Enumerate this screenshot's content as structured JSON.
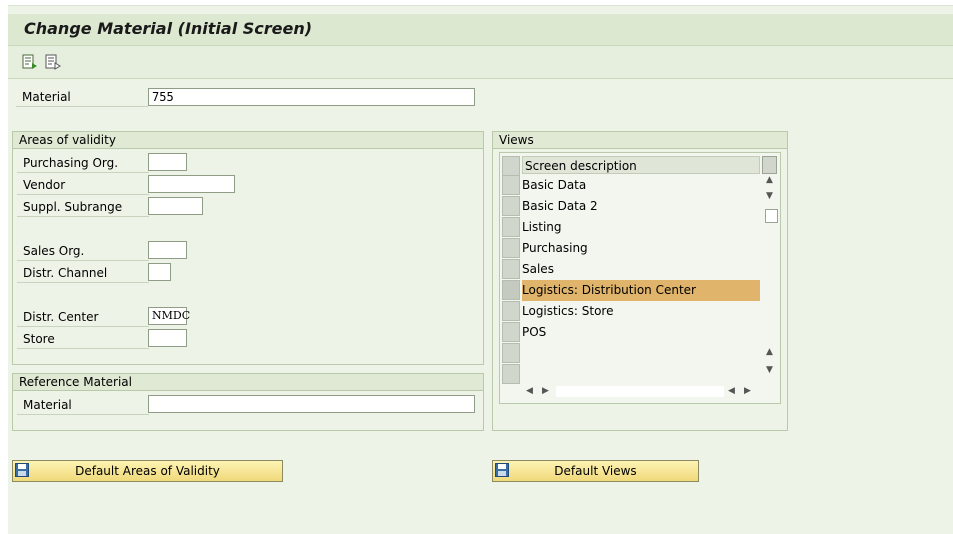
{
  "title": "Change Material (Initial Screen)",
  "toolbar": {
    "icons": [
      "select-views-icon",
      "org-levels-icon"
    ]
  },
  "material": {
    "label": "Material",
    "value": "755"
  },
  "areas_of_validity": {
    "title": "Areas of validity",
    "fields": [
      {
        "label": "Purchasing Org.",
        "value": ""
      },
      {
        "label": "Vendor",
        "value": ""
      },
      {
        "label": "Suppl. Subrange",
        "value": ""
      },
      {
        "label": "Sales Org.",
        "value": ""
      },
      {
        "label": "Distr. Channel",
        "value": ""
      },
      {
        "label": "Distr. Center",
        "value": "NMDC"
      },
      {
        "label": "Store",
        "value": ""
      }
    ]
  },
  "reference_material": {
    "title": "Reference Material",
    "label": "Material",
    "value": ""
  },
  "views": {
    "title": "Views",
    "header": "Screen description",
    "items": [
      "Basic Data",
      "Basic Data 2",
      "Listing",
      "Purchasing",
      "Sales",
      "Logistics: Distribution Center",
      "Logistics: Store",
      "POS"
    ],
    "selected": "Logistics: Distribution Center"
  },
  "buttons": {
    "default_areas": "Default Areas of Validity",
    "default_views": "Default Views"
  },
  "colors": {
    "selected_row": "#e0b46a",
    "button_fill": "#f0d97a"
  }
}
